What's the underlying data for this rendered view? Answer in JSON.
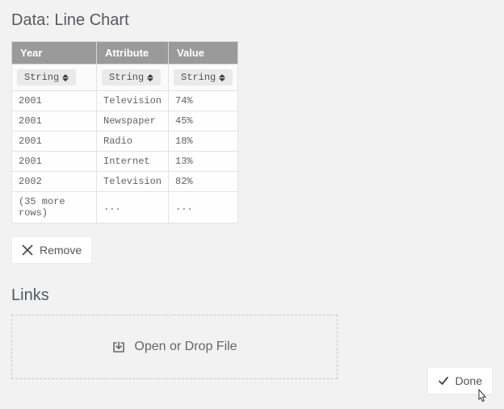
{
  "section_title": "Data: Line Chart",
  "table": {
    "headers": [
      "Year",
      "Attribute",
      "Value"
    ],
    "types": [
      "String",
      "String",
      "String"
    ],
    "rows": [
      {
        "year": "2001",
        "attribute": "Television",
        "value": "74%"
      },
      {
        "year": "2001",
        "attribute": "Newspaper",
        "value": "45%"
      },
      {
        "year": "2001",
        "attribute": "Radio",
        "value": "18%"
      },
      {
        "year": "2001",
        "attribute": "Internet",
        "value": "13%"
      },
      {
        "year": "2002",
        "attribute": "Television",
        "value": "82%"
      }
    ],
    "more_rows_label": "(35 more rows)",
    "ellipsis": "..."
  },
  "remove_label": "Remove",
  "links_title": "Links",
  "dropzone_label": "Open or Drop File",
  "done_label": "Done",
  "chart_data": {
    "type": "table",
    "columns": [
      "Year",
      "Attribute",
      "Value"
    ],
    "rows": [
      [
        "2001",
        "Television",
        "74%"
      ],
      [
        "2001",
        "Newspaper",
        "45%"
      ],
      [
        "2001",
        "Radio",
        "18%"
      ],
      [
        "2001",
        "Internet",
        "13%"
      ],
      [
        "2002",
        "Television",
        "82%"
      ]
    ],
    "hidden_row_count": 35,
    "title": "Data: Line Chart"
  }
}
